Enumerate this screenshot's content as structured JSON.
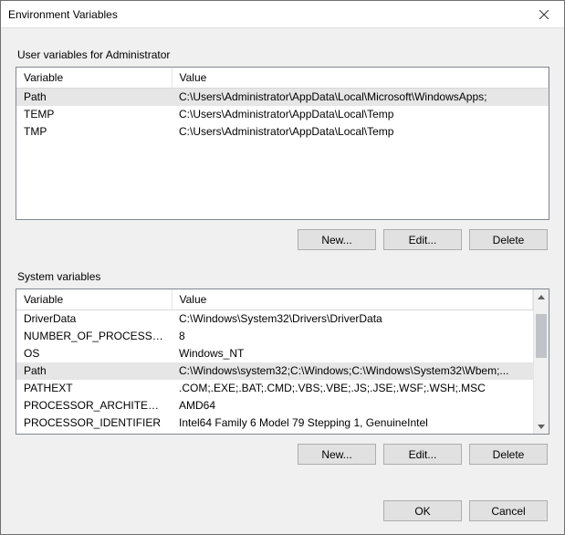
{
  "window": {
    "title": "Environment Variables"
  },
  "user_section": {
    "label": "User variables for Administrator",
    "columns": {
      "variable": "Variable",
      "value": "Value"
    },
    "rows": [
      {
        "variable": "Path",
        "value": "C:\\Users\\Administrator\\AppData\\Local\\Microsoft\\WindowsApps;",
        "selected": true
      },
      {
        "variable": "TEMP",
        "value": "C:\\Users\\Administrator\\AppData\\Local\\Temp",
        "selected": false
      },
      {
        "variable": "TMP",
        "value": "C:\\Users\\Administrator\\AppData\\Local\\Temp",
        "selected": false
      }
    ],
    "buttons": {
      "new": "New...",
      "edit": "Edit...",
      "delete": "Delete"
    }
  },
  "system_section": {
    "label": "System variables",
    "columns": {
      "variable": "Variable",
      "value": "Value"
    },
    "rows": [
      {
        "variable": "DriverData",
        "value": "C:\\Windows\\System32\\Drivers\\DriverData",
        "selected": false
      },
      {
        "variable": "NUMBER_OF_PROCESSORS",
        "value": "8",
        "selected": false
      },
      {
        "variable": "OS",
        "value": "Windows_NT",
        "selected": false
      },
      {
        "variable": "Path",
        "value": "C:\\Windows\\system32;C:\\Windows;C:\\Windows\\System32\\Wbem;...",
        "selected": true
      },
      {
        "variable": "PATHEXT",
        "value": ".COM;.EXE;.BAT;.CMD;.VBS;.VBE;.JS;.JSE;.WSF;.WSH;.MSC",
        "selected": false
      },
      {
        "variable": "PROCESSOR_ARCHITECTURE",
        "value": "AMD64",
        "selected": false
      },
      {
        "variable": "PROCESSOR_IDENTIFIER",
        "value": "Intel64 Family 6 Model 79 Stepping 1, GenuineIntel",
        "selected": false
      }
    ],
    "buttons": {
      "new": "New...",
      "edit": "Edit...",
      "delete": "Delete"
    }
  },
  "footer": {
    "ok": "OK",
    "cancel": "Cancel"
  }
}
